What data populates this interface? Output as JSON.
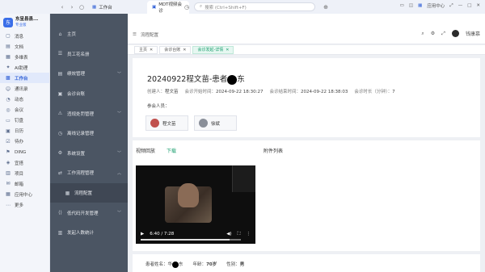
{
  "titlebar": {
    "tabs": [
      {
        "label": "工作台",
        "active": false
      },
      {
        "label": "MDT视频会诊",
        "active": true
      }
    ],
    "search_placeholder": "搜索 (Ctrl+Shift+F)",
    "app_center": "应用中心"
  },
  "org": {
    "name": "东呈县县...",
    "badge": "专业版"
  },
  "leftbar": {
    "items": [
      {
        "label": "消息",
        "icon": "chat-icon"
      },
      {
        "label": "文档",
        "icon": "doc-icon"
      },
      {
        "label": "多维表",
        "icon": "table-icon"
      },
      {
        "label": "AI助理",
        "icon": "ai-icon"
      },
      {
        "label": "工作台",
        "icon": "grid-icon",
        "active": true
      },
      {
        "label": "通讯录",
        "icon": "contacts-icon"
      },
      {
        "label": "动态",
        "icon": "activity-icon"
      },
      {
        "label": "会议",
        "icon": "meeting-icon"
      },
      {
        "label": "钉盘",
        "icon": "drive-icon"
      },
      {
        "label": "日历",
        "icon": "calendar-icon"
      },
      {
        "label": "待办",
        "icon": "todo-icon"
      },
      {
        "label": "DING",
        "icon": "ding-icon"
      },
      {
        "label": "宜搭",
        "icon": "yida-icon"
      },
      {
        "label": "项目",
        "icon": "project-icon"
      },
      {
        "label": "邮箱",
        "icon": "mail-icon"
      },
      {
        "label": "应用中心",
        "icon": "apps-icon"
      },
      {
        "label": "更多",
        "icon": "more-icon"
      }
    ]
  },
  "sidenav": {
    "items": [
      {
        "label": "主页",
        "icon": "home-icon",
        "arrow": false
      },
      {
        "label": "员工花名册",
        "icon": "roster-icon",
        "arrow": false
      },
      {
        "label": "绩效管理",
        "icon": "kpi-icon",
        "arrow": true
      },
      {
        "label": "会诊台账",
        "icon": "ledger-icon",
        "arrow": false
      },
      {
        "label": "违规处罚管理",
        "icon": "penalty-icon",
        "arrow": true
      },
      {
        "label": "离线记录管理",
        "icon": "offline-icon",
        "arrow": false
      },
      {
        "label": "系统设置",
        "icon": "settings-icon",
        "arrow": true
      },
      {
        "label": "工作流程管理",
        "icon": "workflow-icon",
        "arrow": true
      },
      {
        "label": "流程配置",
        "icon": "config-icon",
        "arrow": false,
        "sub": true
      },
      {
        "label": "低代码开发管理",
        "icon": "lowcode-icon",
        "arrow": true
      },
      {
        "label": "发起人数统计",
        "icon": "stats-icon",
        "arrow": false
      }
    ]
  },
  "header": {
    "breadcrumb": "流程配置",
    "user": "钱康慕"
  },
  "pagetabs": [
    {
      "label": "主页",
      "active": false
    },
    {
      "label": "会诊台账",
      "active": false
    },
    {
      "label": "会诊发起-详情",
      "active": true
    }
  ],
  "record": {
    "title_a": "20240922程文苗-患者",
    "title_b": "东",
    "creator_label": "创建人：",
    "creator": "程文苗",
    "start_label": "会诊开始时间：",
    "start": "2024-09-22 18:30:27",
    "end_label": "会诊结束时间：",
    "end": "2024-09-22 18:38:03",
    "duration_label": "会诊时长（分钟）：",
    "duration": "7",
    "participants_label": "参会人员：",
    "participants": [
      {
        "name": "程文苗",
        "color": "#c0504d"
      },
      {
        "name": "徐斌",
        "color": "#8a8f99"
      }
    ]
  },
  "video": {
    "replay_label": "视频回放",
    "download_label": "下载",
    "attachments_label": "附件列表",
    "time": "6:40 / 7:28",
    "progress": 0.89
  },
  "patient": {
    "name_label": "患者姓名：",
    "name_a": "华",
    "name_b": "东",
    "age_label": "年龄：",
    "age": "70岁",
    "gender_label": "性别：",
    "gender": "男"
  }
}
